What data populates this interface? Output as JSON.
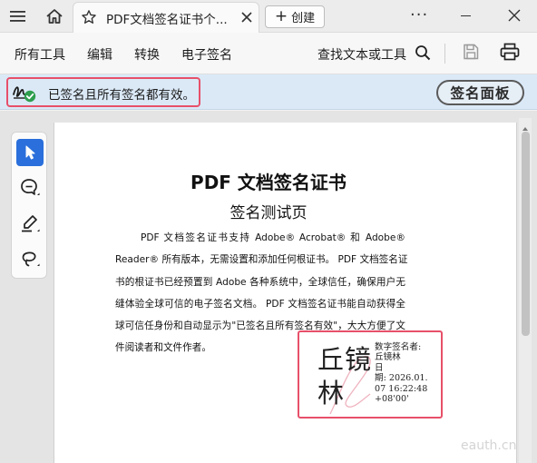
{
  "titlebar": {
    "tab_title": "PDF文档签名证书个...",
    "create_label": "创建",
    "more_label": "···",
    "icons": [
      "hamburger-menu-icon",
      "home-icon",
      "star-icon",
      "close-icon",
      "plus-icon",
      "minimize-icon",
      "window-close-icon"
    ]
  },
  "menubar": {
    "items": [
      "所有工具",
      "编辑",
      "转换",
      "电子签名"
    ],
    "find_label": "查找文本或工具",
    "icons": [
      "search-icon",
      "save-icon",
      "print-icon"
    ]
  },
  "signature_bar": {
    "status_text": "已签名且所有签名都有效。",
    "panel_button": "签名面板",
    "status_icon": "signature-valid-icon"
  },
  "tools": [
    "select-cursor-icon",
    "comment-icon",
    "highlight-pen-icon",
    "draw-lasso-icon"
  ],
  "document": {
    "title": "PDF 文档签名证书",
    "subtitle": "签名测试页",
    "body_lines": [
      "PDF 文档签名证书支持 Adobe® Acrobat® 和 Adobe®",
      "Reader® 所有版本，无需设置和添加任何根证书。 PDF 文档签名证",
      "书的根证书已经预置到 Adobe 各种系统中，全球信任，确保用户无",
      "缝体验全球可信的电子签名文档。 PDF 文档签名证书能自动获得全",
      "球可信任身份和自动显示为\"已签名且所有签名有效\"，大大方便了文",
      "件阅读者和文件作者。"
    ],
    "stamp": {
      "signer_big": "丘镜林",
      "info_lines": [
        "数字签名者:",
        "丘镜林",
        "日",
        "期: 2026.01.",
        "07 16:22:48",
        "+08'00'"
      ]
    }
  },
  "watermark": "eauth.cn",
  "colors": {
    "highlight_border": "#e7506a",
    "signature_bar_bg": "#dbe9f7",
    "active_tool": "#2a6fdb",
    "valid_check": "#2e9e4f"
  }
}
